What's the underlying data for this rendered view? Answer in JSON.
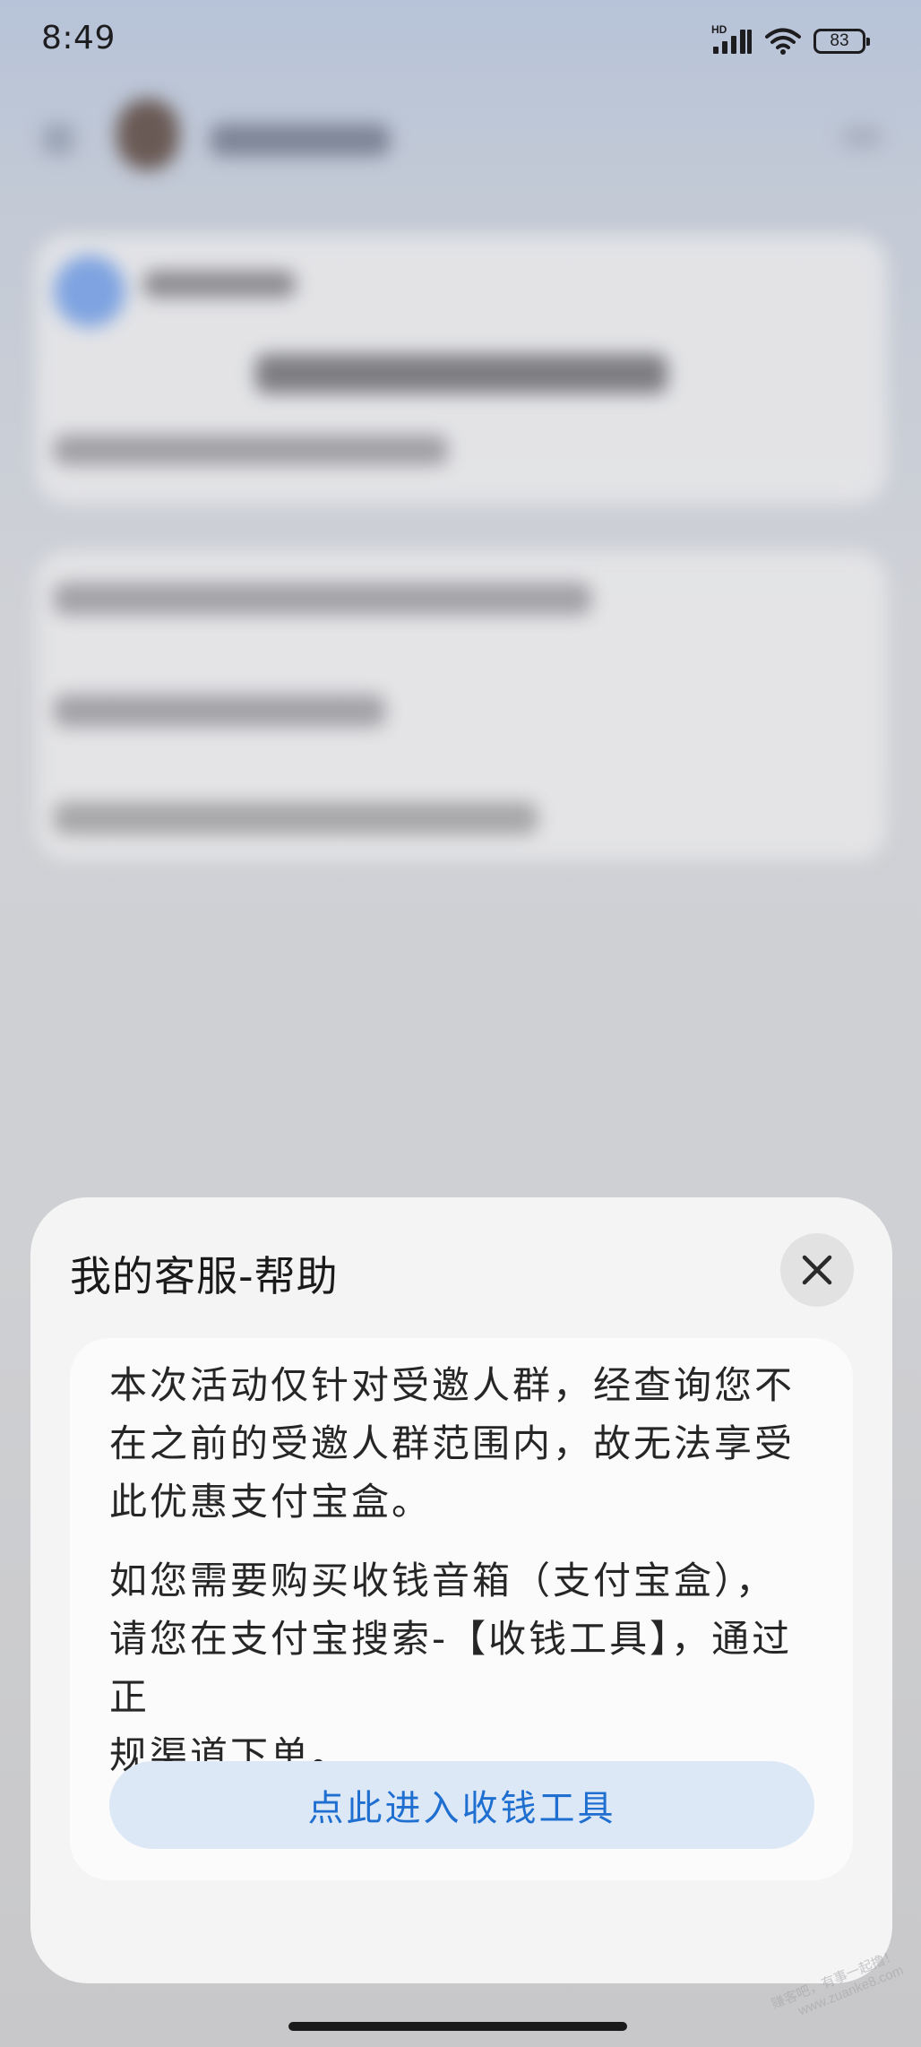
{
  "status_bar": {
    "time": "8:49",
    "battery": "83",
    "network_label": "HD",
    "icons": [
      "hd-signal-icon",
      "wifi-icon",
      "battery-icon"
    ]
  },
  "sheet": {
    "title": "我的客服-帮助",
    "close_icon": "close-icon",
    "message": {
      "paragraph1_lines": [
        "本次活动仅针对受邀人群，经查询您不",
        "在之前的受邀人群范围内，故无法享受",
        "此优惠支付宝盒。"
      ],
      "paragraph2_lines": [
        "如您需要购买收钱音箱（支付宝盒），",
        "请您在支付宝搜索-【收钱工具】，通过正",
        "规渠道下单。"
      ]
    },
    "action_button_label": "点此进入收钱工具"
  },
  "watermark": {
    "line1": "赚客吧，有事一起撸！",
    "line2": "www.zuanke8.com"
  },
  "colors": {
    "accent": "#1f6fd1",
    "button_bg": "#dde8f6",
    "sheet_bg": "#f4f4f4",
    "card_bg": "#fbfbfb"
  }
}
